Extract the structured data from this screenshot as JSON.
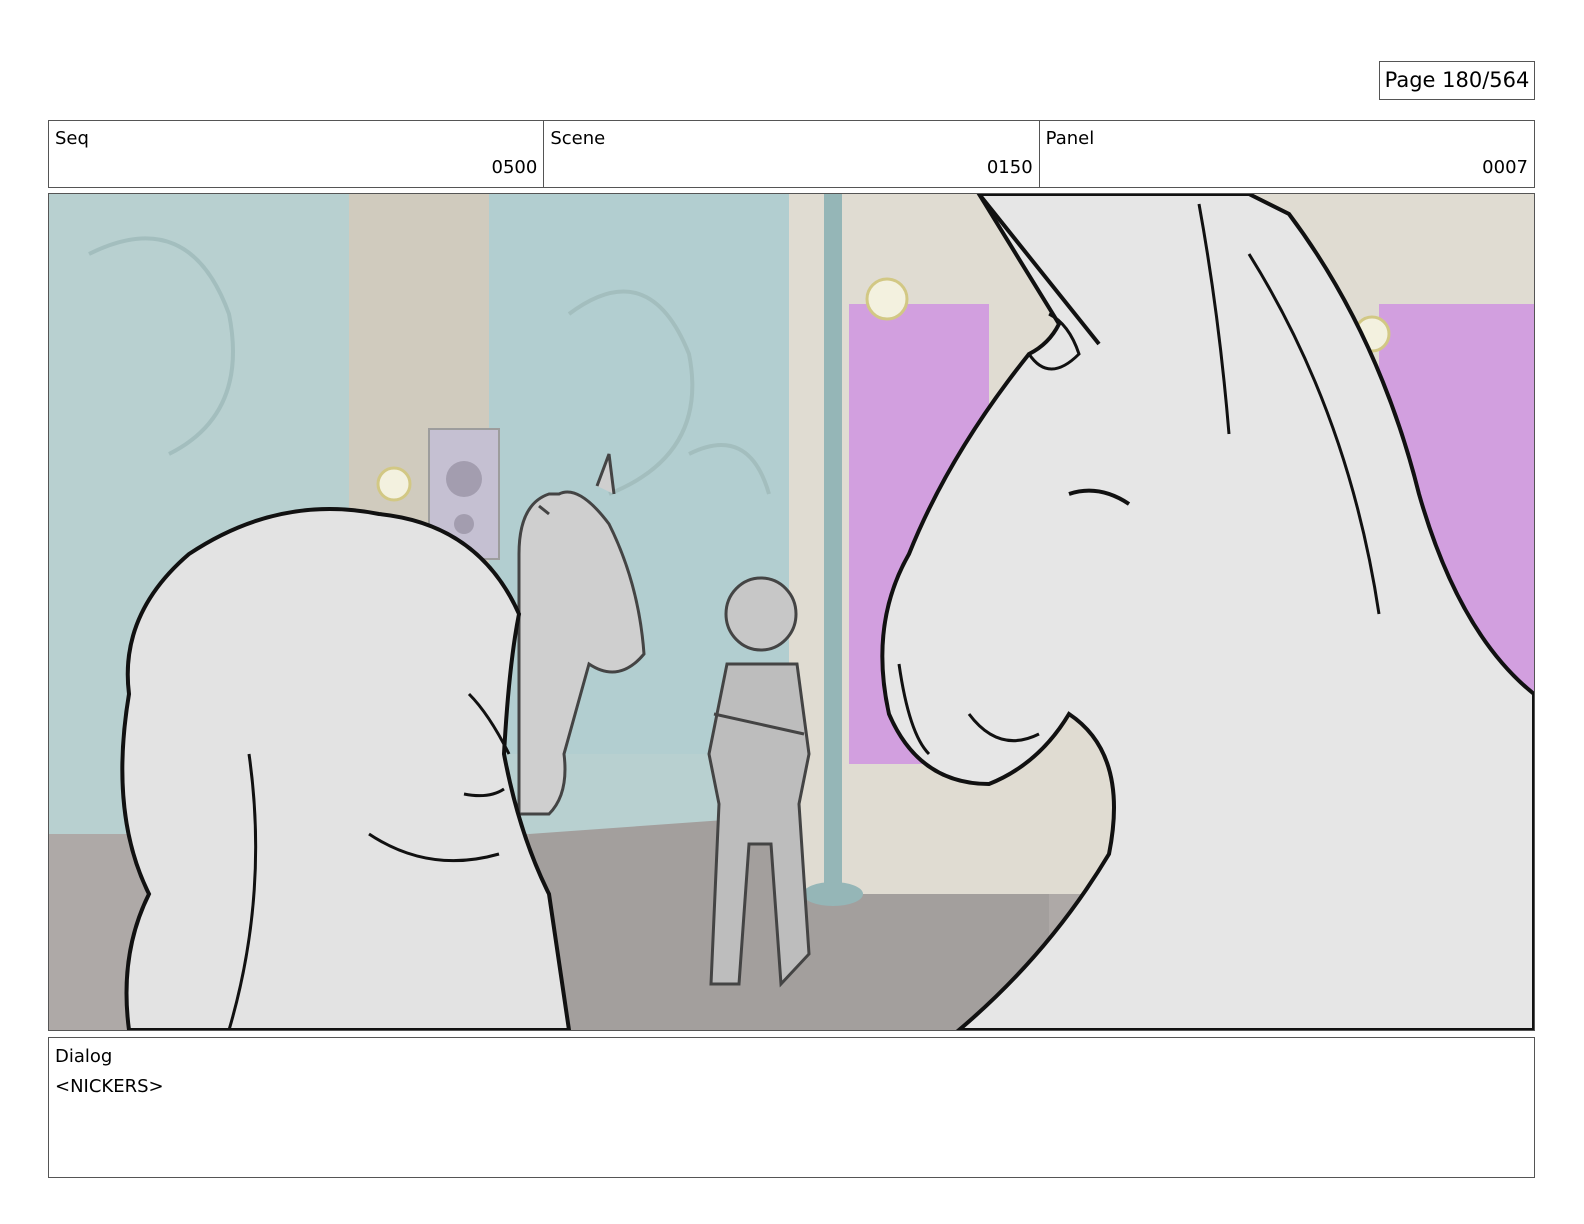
{
  "page": {
    "label": "Page 180/564"
  },
  "header": {
    "seq": {
      "label": "Seq",
      "value": "0500"
    },
    "scene": {
      "label": "Scene",
      "value": "0150"
    },
    "panel": {
      "label": "Panel",
      "value": "0007"
    }
  },
  "dialog": {
    "label": "Dialog",
    "text": "<NICKERS>"
  }
}
